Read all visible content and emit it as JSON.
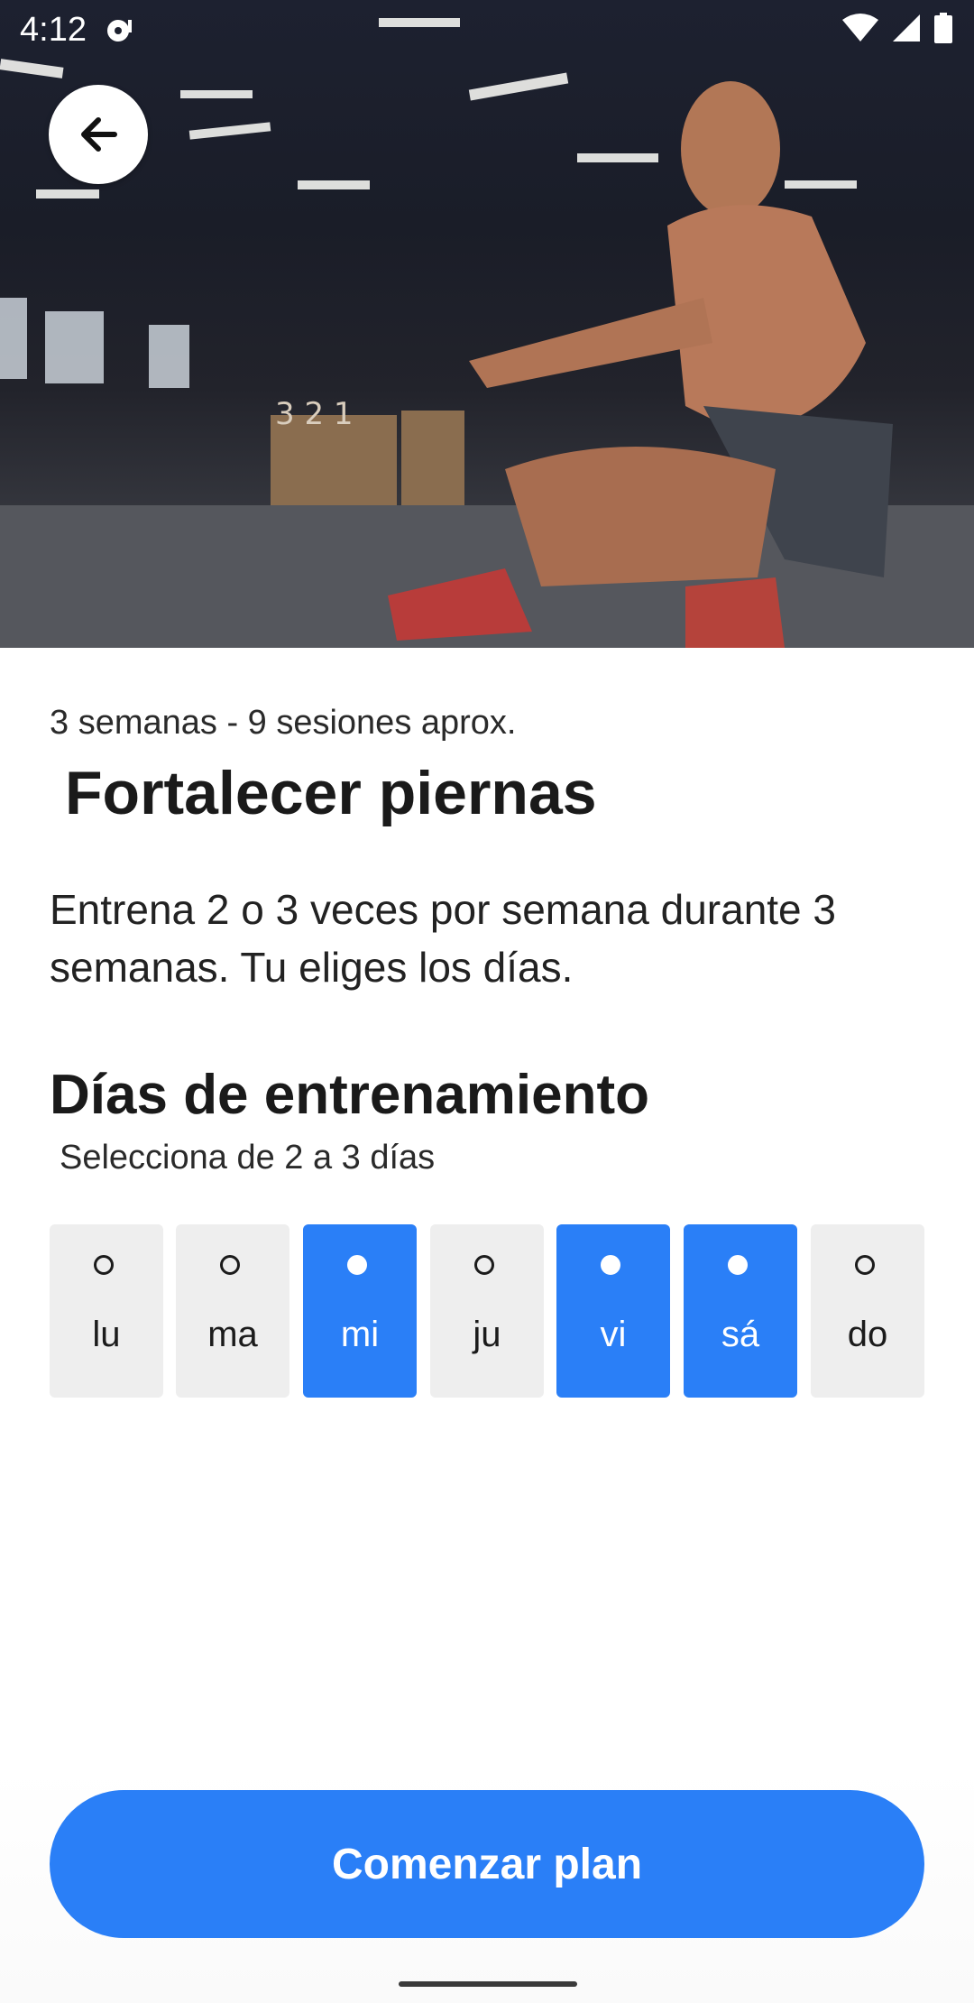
{
  "status_bar": {
    "time": "4:12"
  },
  "hero": {
    "image_subject": "man doing pistol squat in gym",
    "back_icon": "arrow-left-icon"
  },
  "plan": {
    "meta": "3 semanas - 9 sesiones aprox.",
    "title": "Fortalecer piernas",
    "description": "Entrena 2 o 3 veces por semana durante 3 semanas. Tu eliges los días."
  },
  "training_days": {
    "title": "Días de entrenamiento",
    "subtitle": "Selecciona de 2 a 3 días",
    "days": [
      {
        "label": "lu",
        "selected": false
      },
      {
        "label": "ma",
        "selected": false
      },
      {
        "label": "mi",
        "selected": true
      },
      {
        "label": "ju",
        "selected": false
      },
      {
        "label": "vi",
        "selected": true
      },
      {
        "label": "sá",
        "selected": true
      },
      {
        "label": "do",
        "selected": false
      }
    ]
  },
  "actions": {
    "start_label": "Comenzar plan"
  },
  "colors": {
    "accent": "#2a7ff7",
    "day_unselected": "#eeeeee"
  }
}
